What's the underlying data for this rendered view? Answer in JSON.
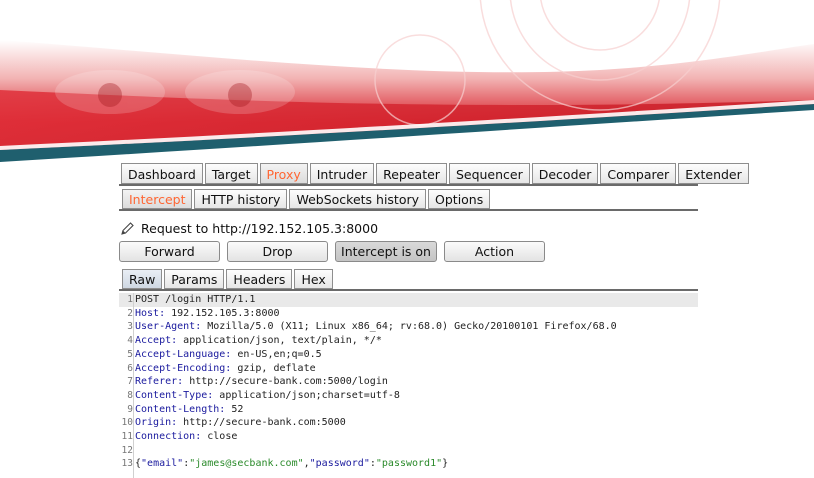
{
  "main_tabs": [
    "Dashboard",
    "Target",
    "Proxy",
    "Intruder",
    "Repeater",
    "Sequencer",
    "Decoder",
    "Comparer",
    "Extender"
  ],
  "proxy_tabs": [
    "Intercept",
    "HTTP history",
    "WebSockets history",
    "Options"
  ],
  "request_to": "Request to http://192.152.105.3:8000",
  "buttons": {
    "forward": "Forward",
    "drop": "Drop",
    "intercept": "Intercept is on",
    "action": "Action"
  },
  "editor_tabs": [
    "Raw",
    "Params",
    "Headers",
    "Hex"
  ],
  "request_lines": [
    {
      "n": "1",
      "name": "",
      "value": "POST /login HTTP/1.1"
    },
    {
      "n": "2",
      "name": "Host:",
      "value": " 192.152.105.3:8000"
    },
    {
      "n": "3",
      "name": "User-Agent:",
      "value": " Mozilla/5.0 (X11; Linux x86_64; rv:68.0) Gecko/20100101 Firefox/68.0"
    },
    {
      "n": "4",
      "name": "Accept:",
      "value": " application/json, text/plain, */*"
    },
    {
      "n": "5",
      "name": "Accept-Language:",
      "value": " en-US,en;q=0.5"
    },
    {
      "n": "6",
      "name": "Accept-Encoding:",
      "value": " gzip, deflate"
    },
    {
      "n": "7",
      "name": "Referer:",
      "value": " http://secure-bank.com:5000/login"
    },
    {
      "n": "8",
      "name": "Content-Type:",
      "value": " application/json;charset=utf-8"
    },
    {
      "n": "9",
      "name": "Content-Length:",
      "value": " 52"
    },
    {
      "n": "10",
      "name": "Origin:",
      "value": " http://secure-bank.com:5000"
    },
    {
      "n": "11",
      "name": "Connection:",
      "value": " close"
    },
    {
      "n": "12",
      "name": "",
      "value": ""
    }
  ],
  "body_line": {
    "n": "13",
    "open": "{",
    "key1": "\"email\"",
    "sep1": ":",
    "val1": "\"james@secbank.com\"",
    "comma": ",",
    "key2": "\"password\"",
    "sep2": ":",
    "val2": "\"password1\"",
    "close": "}"
  },
  "colors": {
    "active_tab": "#ff6633",
    "header_name": "#1a1a9e",
    "json_value": "#2a8a2a",
    "banner_red": "#d4202a",
    "banner_teal": "#1f5f6e"
  },
  "icons": {
    "request": "pencil-icon"
  }
}
